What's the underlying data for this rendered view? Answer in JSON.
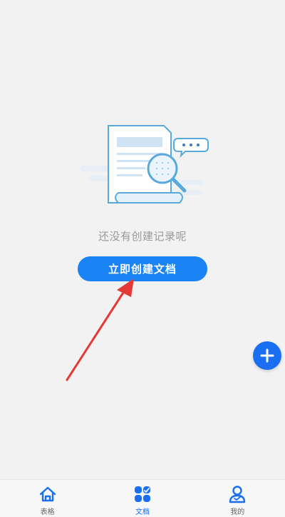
{
  "empty_state": {
    "message": "还没有创建记录呢",
    "create_button_label": "立即创建文档"
  },
  "fab": {
    "icon": "plus-icon"
  },
  "tabbar": {
    "tabs": [
      {
        "label": "表格",
        "icon": "home-icon",
        "active": false
      },
      {
        "label": "文档",
        "icon": "grid-icon",
        "active": true
      },
      {
        "label": "我的",
        "icon": "user-icon",
        "active": false
      }
    ]
  },
  "colors": {
    "accent": "#1a84f5",
    "fab": "#1a6ef2",
    "arrow": "#e53935",
    "background": "#f2f2f2"
  }
}
